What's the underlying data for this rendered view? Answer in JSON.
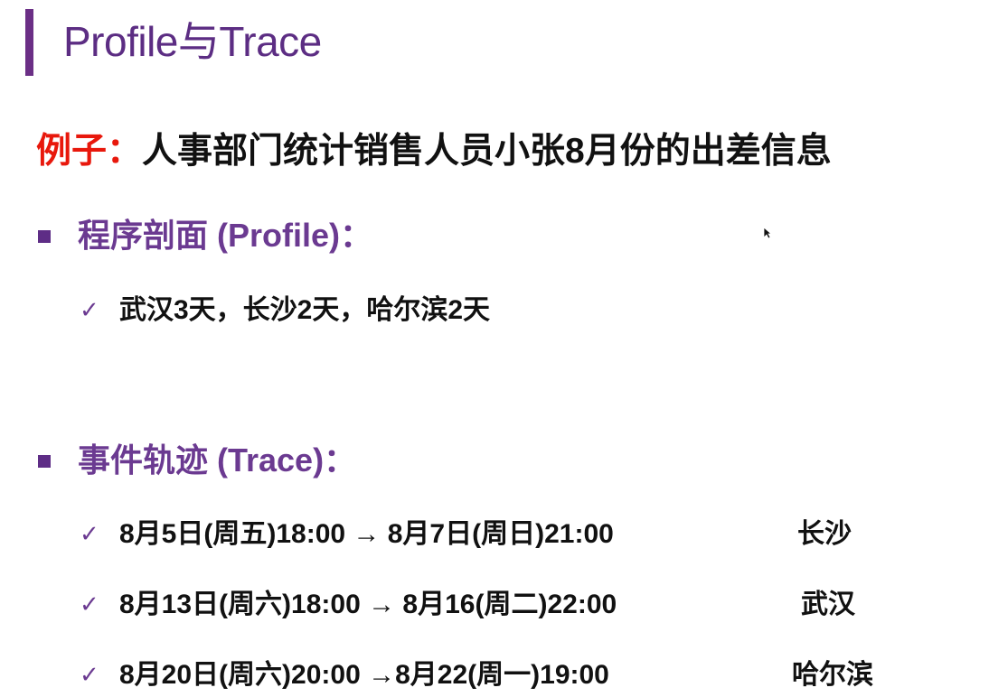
{
  "slide": {
    "title": "Profile与Trace",
    "example": {
      "label": "例子：",
      "text": "人事部门统计销售人员小张8月份的出差信息"
    },
    "sections": [
      {
        "heading": "程序剖面 (Profile)：",
        "items": [
          {
            "text": "武汉3天，长沙2天，哈尔滨2天"
          }
        ]
      },
      {
        "heading": "事件轨迹 (Trace)：",
        "items": [
          {
            "text": "8月5日(周五)18:00 → 8月7日(周日)21:00",
            "city": "长沙"
          },
          {
            "text": "8月13日(周六)18:00 → 8月16(周二)22:00",
            "city": "武汉"
          },
          {
            "text": "8月20日(周六)20:00 →8月22(周一)19:00",
            "city": "哈尔滨"
          }
        ]
      }
    ],
    "check_glyph": "✓",
    "colors": {
      "accent_purple": "#5c2d83",
      "example_red": "#e8180c",
      "text_black": "#111111"
    }
  }
}
